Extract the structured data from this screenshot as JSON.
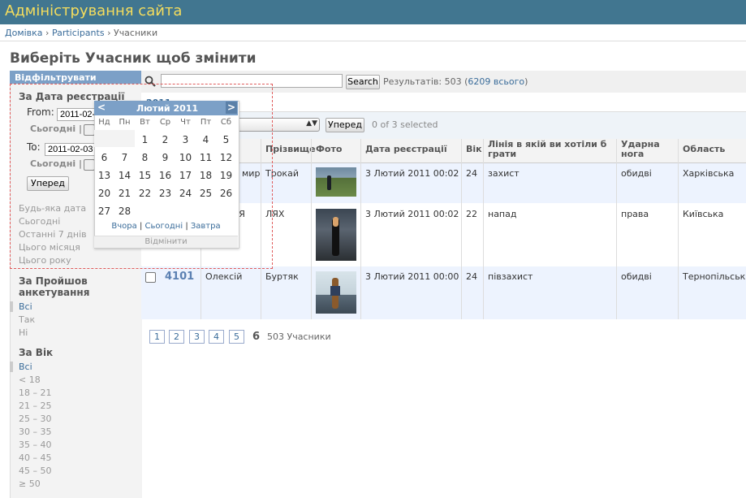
{
  "header": {
    "title": "Адміністрування сайта"
  },
  "breadcrumbs": {
    "home": "Домівка",
    "sep": "›",
    "app": "Participants",
    "current": "Учасники"
  },
  "page_title": "Виберіть Учасник щоб змінити",
  "filter": {
    "title": "Відфільтрувати",
    "date": {
      "heading": "За Дата реєстрації",
      "from_label": "From:",
      "from_value": "2011-02-01",
      "to_label": "To:",
      "to_value": "2011-02-03",
      "today": "Сьогодні",
      "bar": "|",
      "submit": "Уперед",
      "options": [
        "Будь-яка дата",
        "Сьогодні",
        "Останні 7 днів",
        "Цього місяця",
        "Цього року"
      ]
    },
    "survey": {
      "heading": "За Пройшов анкетування",
      "options": [
        "Всі",
        "Так",
        "Ні"
      ]
    },
    "age": {
      "heading": "За Вік",
      "options": [
        "Всі",
        "< 18",
        "18 – 21",
        "21 – 25",
        "25 – 30",
        "30 – 35",
        "35 – 40",
        "40 – 45",
        "45 – 50",
        "≥ 50"
      ]
    }
  },
  "search": {
    "button": "Search",
    "result_prefix": "Результатів: 503 (",
    "result_link": "6209 всього",
    "result_suffix": ")"
  },
  "date_hierarchy": "2011",
  "actions": {
    "arrow": "▲▼",
    "go": "Уперед",
    "selected": "0 of 3 selected"
  },
  "table": {
    "headers": {
      "first": "",
      "surname": "Прізвище",
      "photo": "Фото",
      "date": "Дата реєстрації",
      "age": "Вік",
      "line": "Лінія в якій ви хотіли б грати",
      "foot": "Ударна нога",
      "region": "Область"
    },
    "rows": [
      {
        "id": "",
        "first": "мир",
        "surname": "Трокай",
        "date": "3 Лютий 2011 00:02",
        "age": "24",
        "line": "захист",
        "foot": "обидві",
        "region": "Харківська"
      },
      {
        "id": "",
        "first": "ЛЯ",
        "surname": "ЛЯХ",
        "date": "3 Лютий 2011 00:02",
        "age": "22",
        "line": "напад",
        "foot": "права",
        "region": "Київська"
      },
      {
        "id": "4101",
        "first": "Олексій",
        "surname": "Буртяк",
        "date": "3 Лютий 2011 00:00",
        "age": "24",
        "line": "півзахист",
        "foot": "обидві",
        "region": "Тернопільська"
      }
    ]
  },
  "pagination": {
    "pages": [
      "1",
      "2",
      "3",
      "4",
      "5"
    ],
    "current": "6",
    "total": "503 Учасники"
  },
  "calendar": {
    "prev": "<",
    "next": ">",
    "title": "Лютий 2011",
    "dows": [
      "Нд",
      "Пн",
      "Вт",
      "Ср",
      "Чт",
      "Пт",
      "Сб"
    ],
    "days": [
      "1",
      "2",
      "3",
      "4",
      "5",
      "6",
      "7",
      "8",
      "9",
      "10",
      "11",
      "12",
      "13",
      "14",
      "15",
      "16",
      "17",
      "18",
      "19",
      "20",
      "21",
      "22",
      "23",
      "24",
      "25",
      "26",
      "27",
      "28"
    ],
    "yesterday": "Вчора",
    "today": "Сьогодні",
    "tomorrow": "Завтра",
    "sep": "|",
    "cancel": "Відмінити"
  },
  "colors": {
    "header_bg": "#417690",
    "title_color": "#f5dd5d",
    "accent": "#7ca0c7",
    "link": "#3a6c9a"
  }
}
